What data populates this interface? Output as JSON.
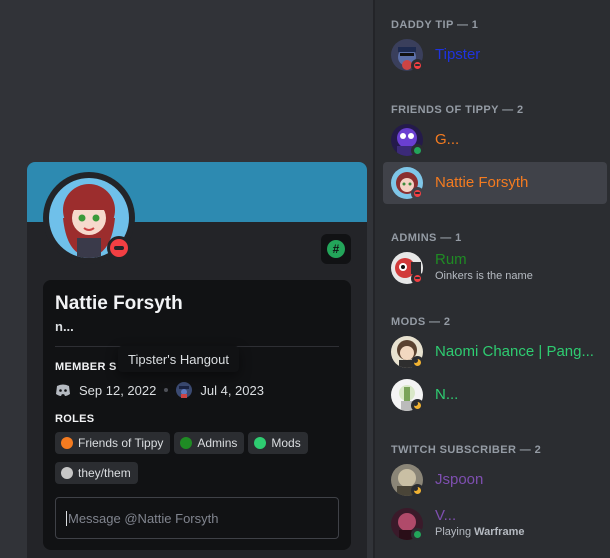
{
  "member_list": {
    "sections": [
      {
        "header": "DADDY TIP — 1",
        "members": [
          {
            "name": "Tipster",
            "color": "#1f33e0",
            "status": "dnd"
          }
        ]
      },
      {
        "header": "FRIENDS OF TIPPY — 2",
        "members": [
          {
            "name": "G...",
            "color": "#f47b20",
            "status": "online"
          },
          {
            "name": "Nattie Forsyth",
            "color": "#f47b20",
            "status": "dnd",
            "selected": true
          }
        ]
      },
      {
        "header": "ADMINS — 1",
        "members": [
          {
            "name": "Rum",
            "color": "#1f8b24",
            "status": "dnd",
            "subtext": "Oinkers is the name"
          }
        ]
      },
      {
        "header": "MODS — 2",
        "members": [
          {
            "name": "Naomi Chance | Pang...",
            "color": "#2ecc71",
            "status": "idle"
          },
          {
            "name": "N...",
            "color": "#2ecc71",
            "status": "idle"
          }
        ]
      },
      {
        "header": "TWITCH SUBSCRIBER — 2",
        "members": [
          {
            "name": "Jspoon",
            "color": "#7e4fb0",
            "status": "idle"
          },
          {
            "name": "V...",
            "color": "#7e4fb0",
            "status": "online",
            "subtext_prefix": "Playing ",
            "subtext_bold": "Warframe"
          }
        ]
      }
    ]
  },
  "profile": {
    "banner_color": "#2d8ab1",
    "display_name": "Nattie Forsyth",
    "username": "n...",
    "member_since_label": "MEMBER S",
    "discord_join_date": "Sep 12, 2022",
    "server_join_date": "Jul 4, 2023",
    "roles_label": "ROLES",
    "roles": [
      {
        "name": "Friends of Tippy",
        "color": "#f47b20"
      },
      {
        "name": "Admins",
        "color": "#1f8b24"
      },
      {
        "name": "Mods",
        "color": "#2ecc71"
      },
      {
        "name": "they/them",
        "color": "#c7c7c7"
      }
    ],
    "message_placeholder": "Message @Nattie Forsyth"
  },
  "tooltip": {
    "text": "Tipster's Hangout"
  },
  "icons": {
    "discord": "discord-logo-icon",
    "server": "server-icon",
    "badge": "hashtag-badge-icon"
  }
}
